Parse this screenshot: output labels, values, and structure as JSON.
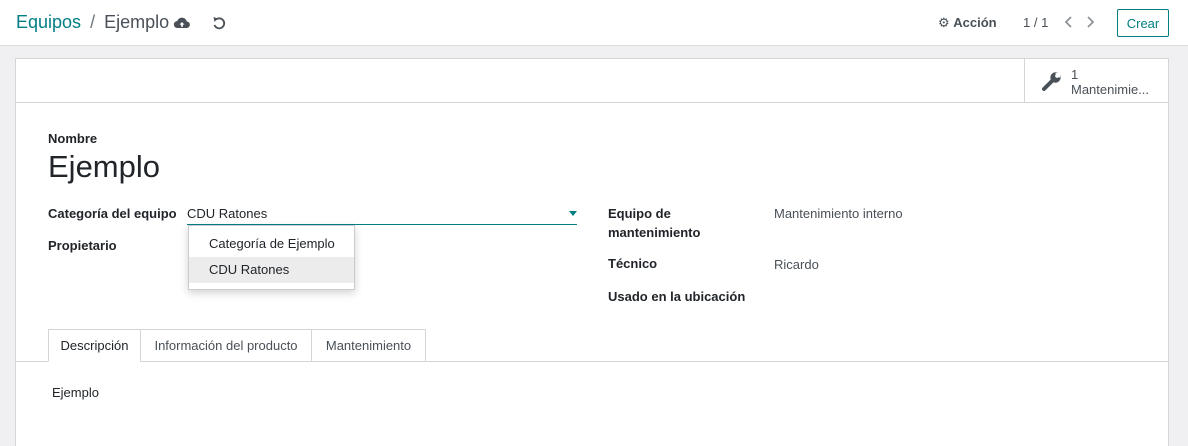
{
  "breadcrumb": {
    "parent": "Equipos",
    "separator": "/",
    "current": "Ejemplo"
  },
  "actions": {
    "accion_label": "Acción"
  },
  "pager": {
    "value": "1 / 1"
  },
  "create_button": {
    "label": "Crear"
  },
  "smart_button": {
    "count": "1",
    "label": "Mantenimie..."
  },
  "form": {
    "name_label": "Nombre",
    "name_value": "Ejemplo",
    "category_label": "Categoría del equipo",
    "category_value": "CDU Ratones",
    "owner_label": "Propietario",
    "team_label_line1": "Equipo de",
    "team_label_line2": "mantenimiento",
    "team_value": "Mantenimiento interno",
    "technician_label": "Técnico",
    "technician_value": "Ricardo",
    "location_label": "Usado en la ubicación"
  },
  "dropdown": {
    "options": [
      "Categoría de Ejemplo",
      "CDU Ratones"
    ],
    "highlighted": "CDU Ratones"
  },
  "tabs": [
    {
      "label": "Descripción",
      "active": true
    },
    {
      "label": "Información del producto",
      "active": false
    },
    {
      "label": "Mantenimiento",
      "active": false
    }
  ],
  "description": "Ejemplo",
  "colors": {
    "accent": "#017e84",
    "text": "#212529",
    "muted": "#495057",
    "border": "#d5d5d5"
  },
  "icons": [
    "cloud-upload-icon",
    "undo-icon",
    "gear-icon",
    "chevron-left-icon",
    "chevron-right-icon",
    "wrench-icon",
    "caret-down-icon"
  ]
}
